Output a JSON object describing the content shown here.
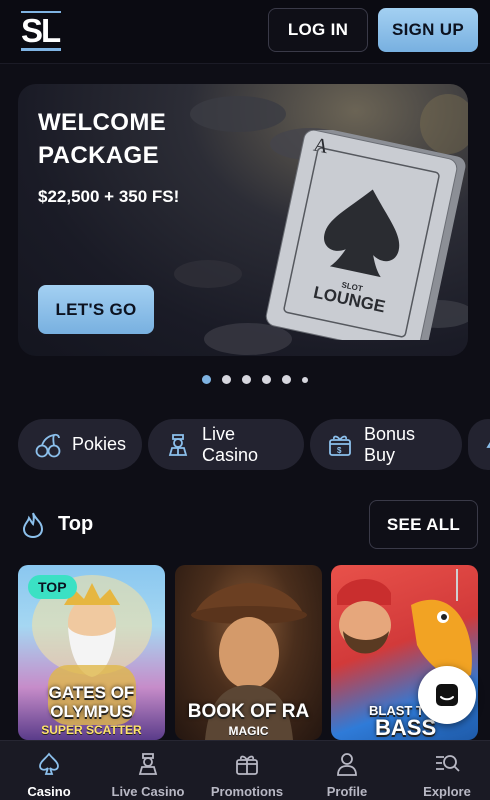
{
  "header": {
    "logo_text": "SL",
    "login_label": "LOG IN",
    "signup_label": "SIGN UP"
  },
  "banner": {
    "title": "WELCOME\nPACKAGE",
    "subtitle": "$22,500 + 350 FS!",
    "cta_label": "LET'S GO",
    "card_brand_top": "SLOT",
    "card_brand": "LOUNGE",
    "card_rank": "A"
  },
  "carousel": {
    "slides": 6,
    "active_index": 0
  },
  "categories": [
    {
      "label": "Pokies",
      "icon": "cherries-icon"
    },
    {
      "label": "Live Casino",
      "icon": "dealer-icon"
    },
    {
      "label": "Bonus Buy",
      "icon": "gift-box-icon"
    }
  ],
  "section": {
    "title": "Top",
    "icon": "flame-icon",
    "see_all_label": "SEE ALL"
  },
  "games": [
    {
      "title": "GATES OF OLYMPUS",
      "subtitle": "SUPER SCATTER",
      "badge": "TOP"
    },
    {
      "title": "BOOK OF RA",
      "subtitle": "MAGIC"
    },
    {
      "title": "BASS",
      "pretitle": "BLAST T"
    }
  ],
  "bottom_nav": [
    {
      "label": "Casino",
      "icon": "spade-icon",
      "active": true
    },
    {
      "label": "Live Casino",
      "icon": "dealer-icon",
      "active": false
    },
    {
      "label": "Promotions",
      "icon": "gift-icon",
      "active": false
    },
    {
      "label": "Profile",
      "icon": "user-icon",
      "active": false
    },
    {
      "label": "Explore",
      "icon": "search-list-icon",
      "active": false
    }
  ],
  "colors": {
    "accent": "#8cc0ec",
    "background": "#0e0e16",
    "badge": "#3be1c4"
  }
}
